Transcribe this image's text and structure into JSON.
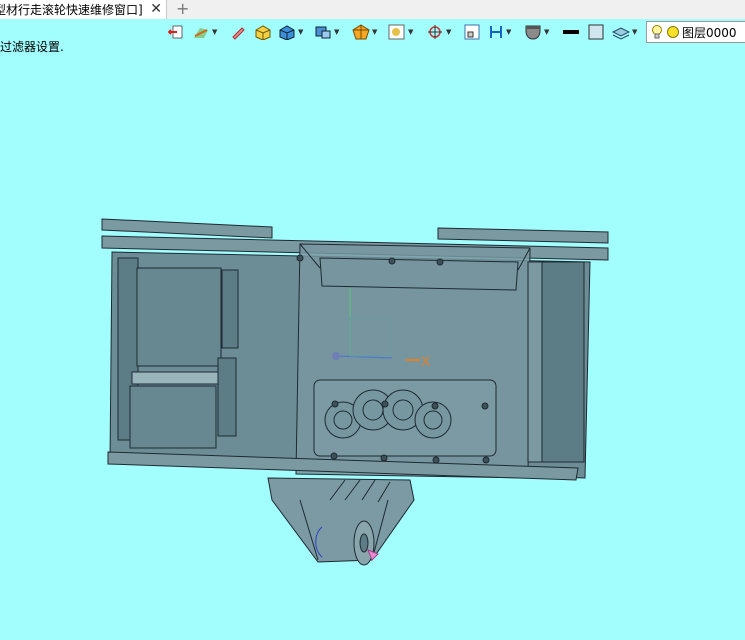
{
  "tab": {
    "title": "型材行走滚轮快速维修窗口]",
    "close": "✕",
    "add": "+"
  },
  "status_text": "过滤器设置.",
  "layer": {
    "label": "图层0000"
  },
  "axis": {
    "x_label": "X"
  },
  "colors": {
    "background": "#a2fdfd",
    "model_fill": "#6c8d95",
    "model_line": "#1f2a33"
  },
  "toolbar": {
    "icons": [
      "exit-sketch-icon",
      "fillet-icon",
      "edit-pen-icon",
      "box-solid-icon",
      "cube-icon",
      "view-orient-icon",
      "render-mode-icon",
      "display-icon",
      "locate-icon",
      "sketch-plane-icon",
      "dimension-icon",
      "color-fill-icon",
      "line-color-icon",
      "surface-color-icon",
      "layer-icon",
      "lightbulb-icon",
      "layer-status-icon"
    ]
  }
}
